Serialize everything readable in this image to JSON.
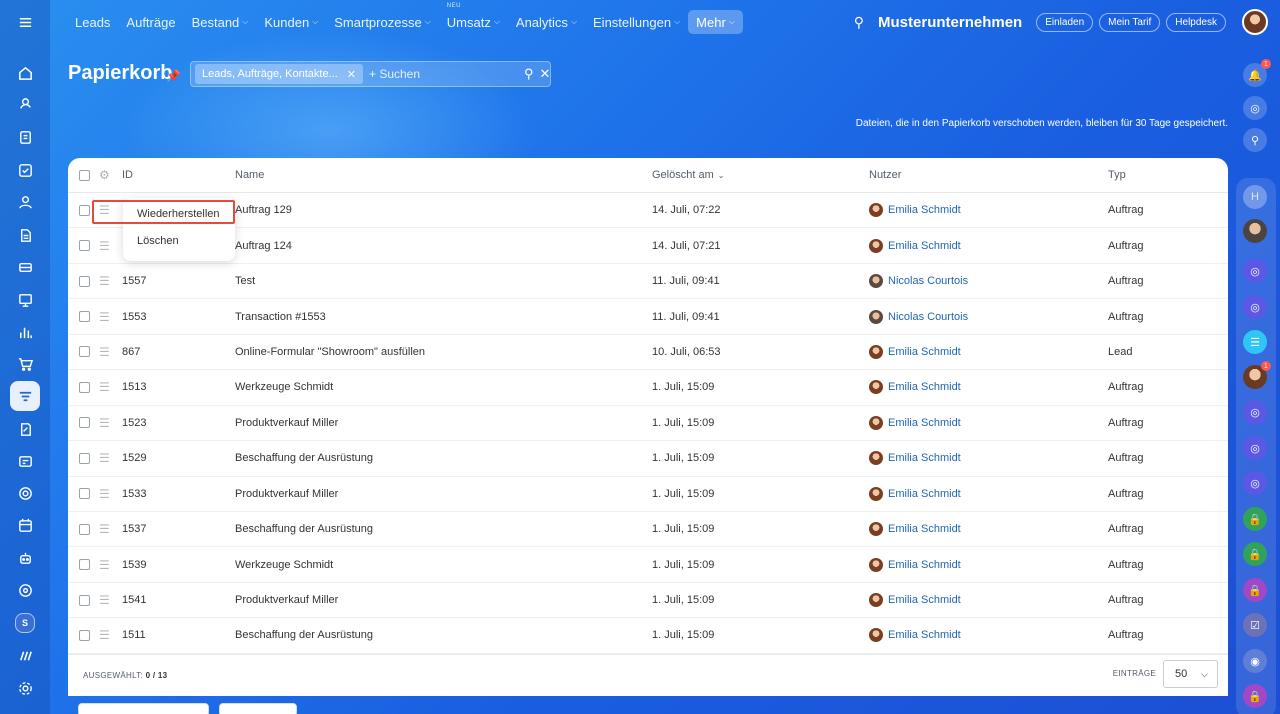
{
  "nav": {
    "items": [
      {
        "label": "Leads",
        "chevron": false,
        "new": false,
        "active": false
      },
      {
        "label": "Aufträge",
        "chevron": false,
        "new": false,
        "active": false
      },
      {
        "label": "Bestand",
        "chevron": true,
        "new": false,
        "active": false
      },
      {
        "label": "Kunden",
        "chevron": true,
        "new": false,
        "active": false
      },
      {
        "label": "Smartprozesse",
        "chevron": true,
        "new": false,
        "active": false
      },
      {
        "label": "Umsatz",
        "chevron": true,
        "new": true,
        "active": false
      },
      {
        "label": "Analytics",
        "chevron": true,
        "new": false,
        "active": false
      },
      {
        "label": "Einstellungen",
        "chevron": true,
        "new": false,
        "active": false
      },
      {
        "label": "Mehr",
        "chevron": true,
        "new": false,
        "active": true
      }
    ],
    "new_badge": "NEU",
    "company": "Musterunternehmen",
    "invite_label": "Einladen",
    "plan_label": "Mein Tarif",
    "helpdesk_label": "Helpdesk"
  },
  "sidebar": {
    "icons": [
      "home-icon",
      "leads-icon",
      "document-icon",
      "task-icon",
      "contacts-icon",
      "invoice-icon",
      "inventory-icon",
      "board-icon",
      "analytics-icon",
      "cart-icon",
      "filter-icon",
      "sign-icon",
      "card-icon",
      "support-icon",
      "calendar-icon",
      "robot-icon",
      "target-icon"
    ],
    "user_initial": "S"
  },
  "header": {
    "title": "Papierkorb",
    "filter_chip": "Leads, Aufträge, Kontakte...",
    "search_placeholder": "+ Suchen",
    "info": "Dateien, die in den Papierkorb verschoben werden, bleiben für 30 Tage gespeichert."
  },
  "table": {
    "headers": {
      "id": "ID",
      "name": "Name",
      "date": "Gelöscht am",
      "user": "Nutzer",
      "type": "Typ"
    },
    "rows": [
      {
        "id": "",
        "name": "Auftrag 129",
        "date": "14. Juli, 07:22",
        "user": "Emilia Schmidt",
        "type": "Auftrag",
        "avatar": "f"
      },
      {
        "id": "",
        "name": "Auftrag 124",
        "date": "14. Juli, 07:21",
        "user": "Emilia Schmidt",
        "type": "Auftrag",
        "avatar": "f"
      },
      {
        "id": "1557",
        "name": "Test",
        "date": "11. Juli, 09:41",
        "user": "Nicolas Courtois",
        "type": "Auftrag",
        "avatar": "m"
      },
      {
        "id": "1553",
        "name": "Transaction #1553",
        "date": "11. Juli, 09:41",
        "user": "Nicolas Courtois",
        "type": "Auftrag",
        "avatar": "m"
      },
      {
        "id": "867",
        "name": "Online-Formular \"Showroom\" ausfüllen",
        "date": "10. Juli, 06:53",
        "user": "Emilia Schmidt",
        "type": "Lead",
        "avatar": "f"
      },
      {
        "id": "1513",
        "name": "Werkzeuge Schmidt",
        "date": "1. Juli, 15:09",
        "user": "Emilia Schmidt",
        "type": "Auftrag",
        "avatar": "f"
      },
      {
        "id": "1523",
        "name": "Produktverkauf Miller",
        "date": "1. Juli, 15:09",
        "user": "Emilia Schmidt",
        "type": "Auftrag",
        "avatar": "f"
      },
      {
        "id": "1529",
        "name": "Beschaffung der Ausrüstung",
        "date": "1. Juli, 15:09",
        "user": "Emilia Schmidt",
        "type": "Auftrag",
        "avatar": "f"
      },
      {
        "id": "1533",
        "name": "Produktverkauf Miller",
        "date": "1. Juli, 15:09",
        "user": "Emilia Schmidt",
        "type": "Auftrag",
        "avatar": "f"
      },
      {
        "id": "1537",
        "name": "Beschaffung der Ausrüstung",
        "date": "1. Juli, 15:09",
        "user": "Emilia Schmidt",
        "type": "Auftrag",
        "avatar": "f"
      },
      {
        "id": "1539",
        "name": "Werkzeuge Schmidt",
        "date": "1. Juli, 15:09",
        "user": "Emilia Schmidt",
        "type": "Auftrag",
        "avatar": "f"
      },
      {
        "id": "1541",
        "name": "Produktverkauf Miller",
        "date": "1. Juli, 15:09",
        "user": "Emilia Schmidt",
        "type": "Auftrag",
        "avatar": "f"
      },
      {
        "id": "1511",
        "name": "Beschaffung der Ausrüstung",
        "date": "1. Juli, 15:09",
        "user": "Emilia Schmidt",
        "type": "Auftrag",
        "avatar": "f"
      }
    ]
  },
  "footer": {
    "selected_label": "AUSGEWÄHLT:",
    "selected_value": "0 / 13",
    "entries_label": "EINTRÄGE",
    "entries_value": "50"
  },
  "popup": {
    "restore": "Wiederherstellen",
    "delete": "Löschen"
  },
  "right_bar": {
    "notification_count": "1",
    "chat_count": "1",
    "contact_initial": "H"
  },
  "colors": {
    "accent": "#1f74ea",
    "link": "#2067b0",
    "highlight": "#e44a3e"
  }
}
